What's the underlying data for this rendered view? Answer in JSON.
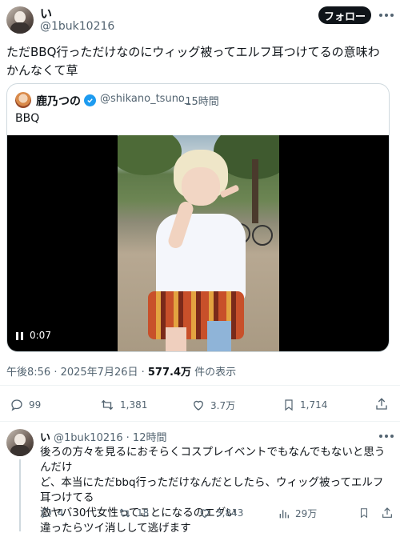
{
  "post": {
    "author_name": "い",
    "author_handle": "@1buk10216",
    "follow_label": "フォロー",
    "text": "ただBBQ行っただけなのにウィッグ被ってエルフ耳つけてるの意味わかんなくて草",
    "timestamp": "午後8:56 · 2025年7月26日 · ",
    "views_count": "577.4万",
    "views_suffix": " 件の表示",
    "stats": {
      "replies": "99",
      "reposts": "1,381",
      "likes": "3.7万",
      "bookmarks": "1,714"
    }
  },
  "quote": {
    "author_name": "鹿乃つの",
    "author_handle": "@shikano_tsuno_",
    "time": "· 15時間",
    "text": "BBQ",
    "video_time": "0:07"
  },
  "reply": {
    "author_name": "い",
    "author_handle": "@1buk10216",
    "time": "· 12時間",
    "lines": [
      "後ろの方々を見るにおそらくコスプレイベントでもなんでもないと思うんだけ",
      "ど、本当にただbbq行っただけなんだとしたら、ウィッグ被ってエルフ耳つけてる",
      "激ヤバ30代女性ってことになるのエグい",
      "違ったらツイ消しして逃げます"
    ],
    "stats": {
      "replies": "4",
      "reposts": "18",
      "likes": "3,843",
      "views": "29万"
    }
  },
  "colors": {
    "text": "#0f1419",
    "secondary": "#536471",
    "accent": "#1d9bf0",
    "border": "#cfd9de"
  }
}
